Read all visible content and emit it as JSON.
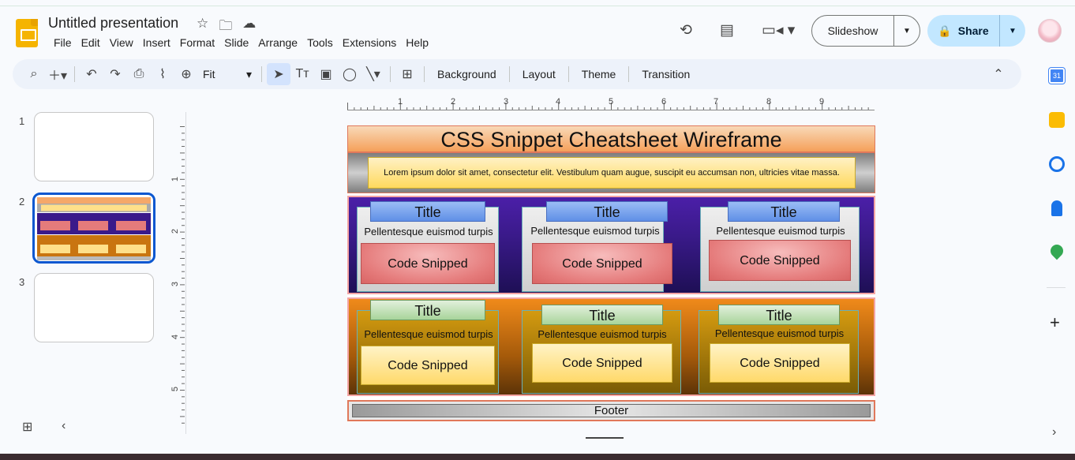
{
  "app": {
    "doc_title": "Untitled presentation",
    "menu": [
      "File",
      "Edit",
      "View",
      "Insert",
      "Format",
      "Slide",
      "Arrange",
      "Tools",
      "Extensions",
      "Help"
    ],
    "slideshow_label": "Slideshow",
    "share_label": "Share"
  },
  "toolbar": {
    "zoom_value": "Fit",
    "background_label": "Background",
    "layout_label": "Layout",
    "theme_label": "Theme",
    "transition_label": "Transition"
  },
  "filmstrip": {
    "slides": [
      {
        "number": "1"
      },
      {
        "number": "2"
      },
      {
        "number": "3"
      }
    ],
    "selected": "2"
  },
  "ruler": {
    "h": [
      "1",
      "2",
      "3",
      "4",
      "5",
      "6",
      "7",
      "8",
      "9"
    ],
    "v": [
      "1",
      "2",
      "3",
      "4",
      "5"
    ]
  },
  "slide": {
    "title": "CSS Snippet Cheatsheet Wireframe",
    "lorem": "Lorem ipsum dolor sit amet, consectetur elit. Vestibulum quam augue, suscipit eu accumsan non, ultricies vitae massa.",
    "row1": [
      {
        "title": "Title",
        "sub": "Pellentesque euismod turpis",
        "code": "Code Snipped"
      },
      {
        "title": "Title",
        "sub": "Pellentesque euismod turpis",
        "code": "Code Snipped"
      },
      {
        "title": "Title",
        "sub": "Pellentesque euismod turpis",
        "code": "Code Snipped"
      }
    ],
    "row2": [
      {
        "title": "Title",
        "sub": "Pellentesque euismod turpis",
        "code": "Code Snipped"
      },
      {
        "title": "Title",
        "sub": "Pellentesque euismod turpis",
        "code": "Code Snipped"
      },
      {
        "title": "Title",
        "sub": "Pellentesque euismod turpis",
        "code": "Code Snipped"
      }
    ],
    "footer": "Footer"
  },
  "colors": {
    "accent": "#0b57d0",
    "share_bg": "#c2e7ff",
    "toolbar_bg": "#edf2fa"
  },
  "icons": {
    "side_panel": [
      "calendar-icon",
      "keep-icon",
      "tasks-icon",
      "contacts-icon",
      "maps-icon",
      "add-icon"
    ]
  }
}
